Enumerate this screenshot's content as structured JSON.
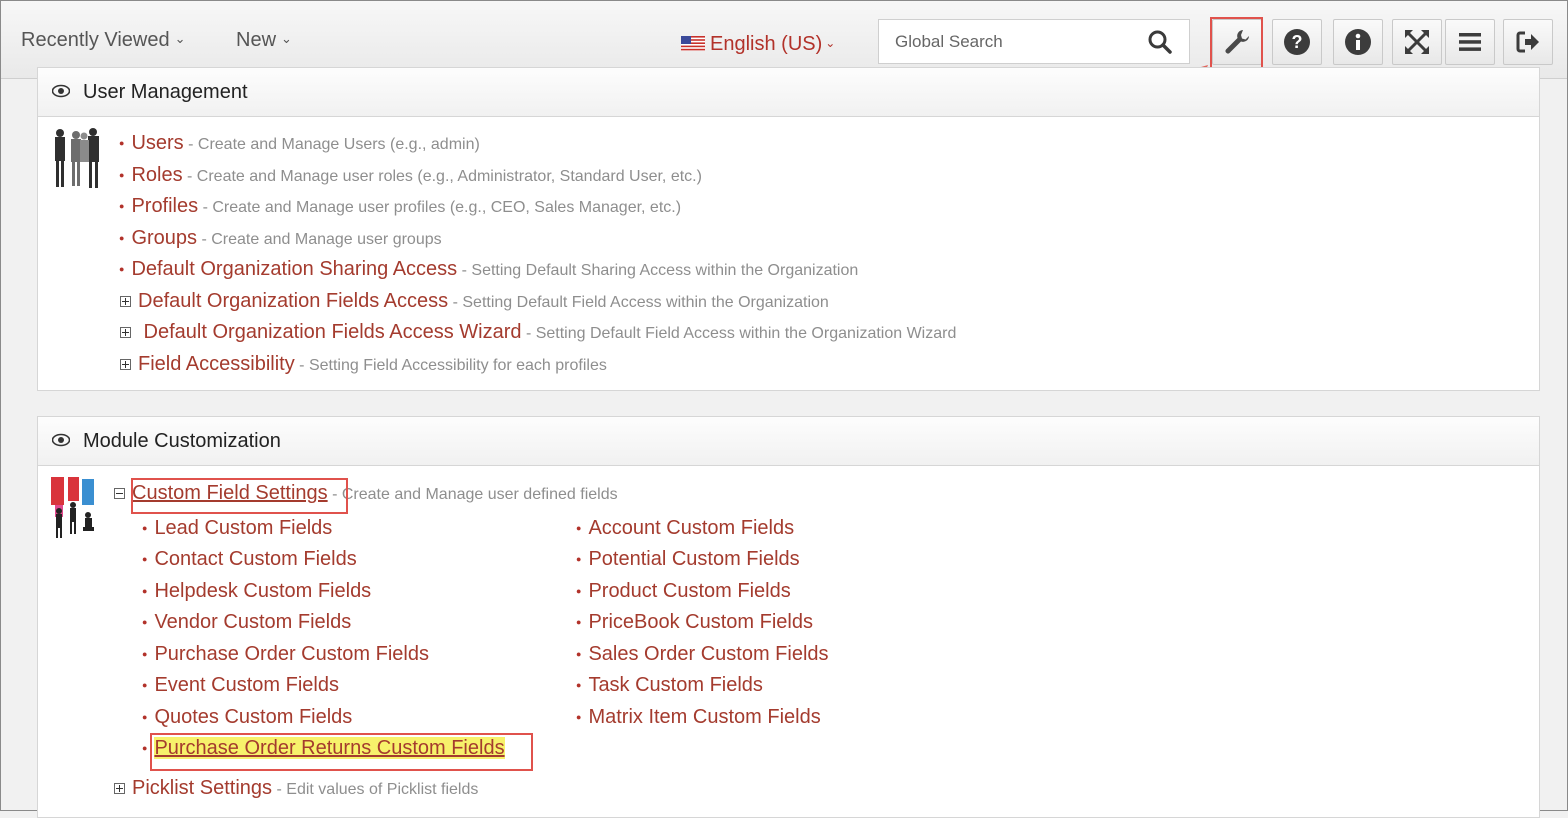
{
  "header": {
    "recently_viewed": "Recently Viewed",
    "new_label": "New",
    "language": "English (US)",
    "search_placeholder": "Global Search"
  },
  "user_management": {
    "title": "User Management",
    "items": [
      {
        "label": "Users",
        "desc": " - Create and Manage Users (e.g., admin)"
      },
      {
        "label": "Roles",
        "desc": " - Create and Manage user roles (e.g., Administrator, Standard User, etc.)"
      },
      {
        "label": "Profiles",
        "desc": " - Create and Manage user profiles (e.g., CEO, Sales Manager, etc.)"
      },
      {
        "label": "Groups",
        "desc": " - Create and Manage user groups"
      },
      {
        "label": "Default Organization Sharing Access",
        "desc": " - Setting Default Sharing Access within the Organization"
      },
      {
        "label": "Default Organization Fields Access",
        "desc": " - Setting Default Field Access within the Organization"
      },
      {
        "label": " Default Organization Fields Access Wizard",
        "desc": " - Setting Default Field Access within the Organization Wizard"
      },
      {
        "label": "Field Accessibility",
        "desc": " - Setting Field Accessibility for each profiles"
      }
    ]
  },
  "module_customization": {
    "title": "Module Customization",
    "custom_field_settings": {
      "label": "Custom Field Settings",
      "desc": " - Create and Manage user defined fields"
    },
    "left_fields": [
      "Lead Custom Fields",
      "Contact Custom Fields",
      "Helpdesk Custom Fields",
      "Vendor Custom Fields",
      "Purchase Order Custom Fields",
      "Event Custom Fields",
      "Quotes Custom Fields",
      "Purchase Order Returns Custom Fields"
    ],
    "right_fields": [
      "Account Custom Fields",
      "Potential Custom Fields",
      "Product Custom Fields",
      "PriceBook Custom Fields",
      "Sales Order Custom Fields",
      "Task Custom Fields",
      "Matrix Item Custom Fields"
    ],
    "picklist": {
      "label": "Picklist Settings",
      "desc": " - Edit values of Picklist fields"
    }
  },
  "colors": {
    "link": "#a43b2e",
    "highlight_border": "#e0524c",
    "highlight_fill": "#f7f26b"
  }
}
